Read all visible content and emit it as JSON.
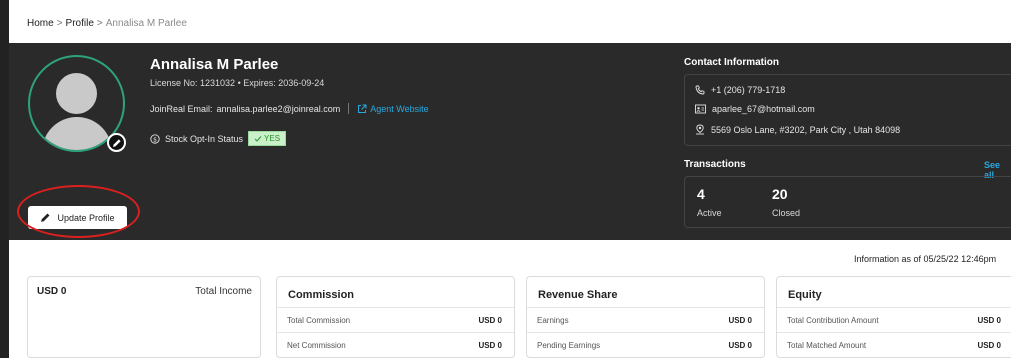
{
  "breadcrumb": {
    "home": "Home",
    "sep1": ">",
    "profile": "Profile",
    "sep2": ">",
    "current": "Annalisa M Parlee"
  },
  "profile": {
    "name": "Annalisa M Parlee",
    "license": "License No: 1231032  •  Expires: 2036-09-24",
    "email_label": "JoinReal Email:",
    "email": "annalisa.parlee2@joinreal.com",
    "website_label": "Agent Website",
    "stock_label": "Stock Opt-In Status",
    "stock_value": "YES",
    "update_button": "Update Profile"
  },
  "contact": {
    "title": "Contact Information",
    "phone": "+1 (206) 779-1718",
    "email": "aparlee_67@hotmail.com",
    "address": "5569 Oslo Lane, #3202, Park City , Utah 84098"
  },
  "transactions": {
    "title": "Transactions",
    "see_all": "See all",
    "active_count": "4",
    "active_label": "Active",
    "closed_count": "20",
    "closed_label": "Closed"
  },
  "info_as_of": "Information as of 05/25/22 12:46pm",
  "income": {
    "value": "USD 0",
    "label": "Total Income"
  },
  "commission": {
    "title": "Commission",
    "rows": [
      {
        "label": "Total Commission",
        "value": "USD 0"
      },
      {
        "label": "Net Commission",
        "value": "USD 0"
      }
    ]
  },
  "revenue_share": {
    "title": "Revenue Share",
    "rows": [
      {
        "label": "Earnings",
        "value": "USD 0"
      },
      {
        "label": "Pending Earnings",
        "value": "USD 0"
      }
    ]
  },
  "equity": {
    "title": "Equity",
    "rows": [
      {
        "label": "Total Contribution Amount",
        "value": "USD 0"
      },
      {
        "label": "Total Matched Amount",
        "value": "USD 0"
      }
    ]
  },
  "colors": {
    "hero_bg": "#2a2a2a",
    "accent_green": "#2ea37b",
    "link_blue": "#29a9e0",
    "highlight_red": "#d82020"
  }
}
